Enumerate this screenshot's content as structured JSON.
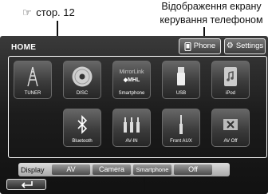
{
  "annotations": {
    "page_ref_icon": "☞",
    "page_ref": "стор. 12",
    "phone_note_line1": "Відображення екрану",
    "phone_note_line2": "керування телефоном"
  },
  "header": {
    "title": "HOME",
    "phone_button": "Phone",
    "settings_button": "Settings"
  },
  "sources": [
    {
      "label": "TUNER",
      "icon": "tuner-antenna-icon"
    },
    {
      "label": "DISC",
      "icon": "disc-icon"
    },
    {
      "label": "Smartphone",
      "icon": "mirrorlink-mhl-icon",
      "logo_top": "MirrorLink",
      "logo_bottom": "◆MHL"
    },
    {
      "label": "USB",
      "icon": "usb-icon"
    },
    {
      "label": "iPod",
      "icon": "ipod-icon"
    },
    {
      "label": "Bluetooth",
      "icon": "bluetooth-icon"
    },
    {
      "label": "AV-IN",
      "icon": "av-in-icon"
    },
    {
      "label": "Front AUX",
      "icon": "front-aux-icon"
    },
    {
      "label": "AV Off",
      "icon": "av-off-icon"
    }
  ],
  "display_bar": {
    "label": "Display",
    "options": [
      "AV",
      "Camera",
      "Smartphone",
      "Off"
    ]
  },
  "footer": {
    "back_icon": "back-arrow-icon"
  },
  "colors": {
    "bracket": "#ffffff",
    "screen_bg": "#1c1c1c"
  }
}
